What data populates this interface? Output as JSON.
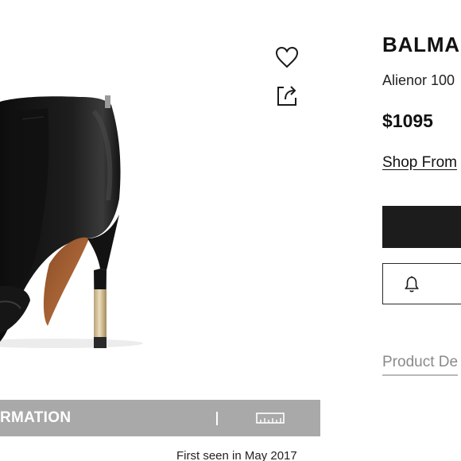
{
  "product": {
    "brand": "BALMA",
    "name": "Alienor 100",
    "price": "$1095",
    "shop_link_label": "Shop From"
  },
  "actions": {
    "favorite_icon": "heart-icon",
    "share_icon": "share-icon",
    "alert_icon": "bell-icon"
  },
  "tabs": {
    "product_details_label": "Product De"
  },
  "info_banner": {
    "label": "RMATION",
    "size_icon": "ruler-icon"
  },
  "meta": {
    "first_seen": "First seen in May 2017"
  },
  "colors": {
    "primary_button": "#1c1c1c",
    "banner_background": "#a9a9a9",
    "muted_text": "#8a8a8a"
  }
}
